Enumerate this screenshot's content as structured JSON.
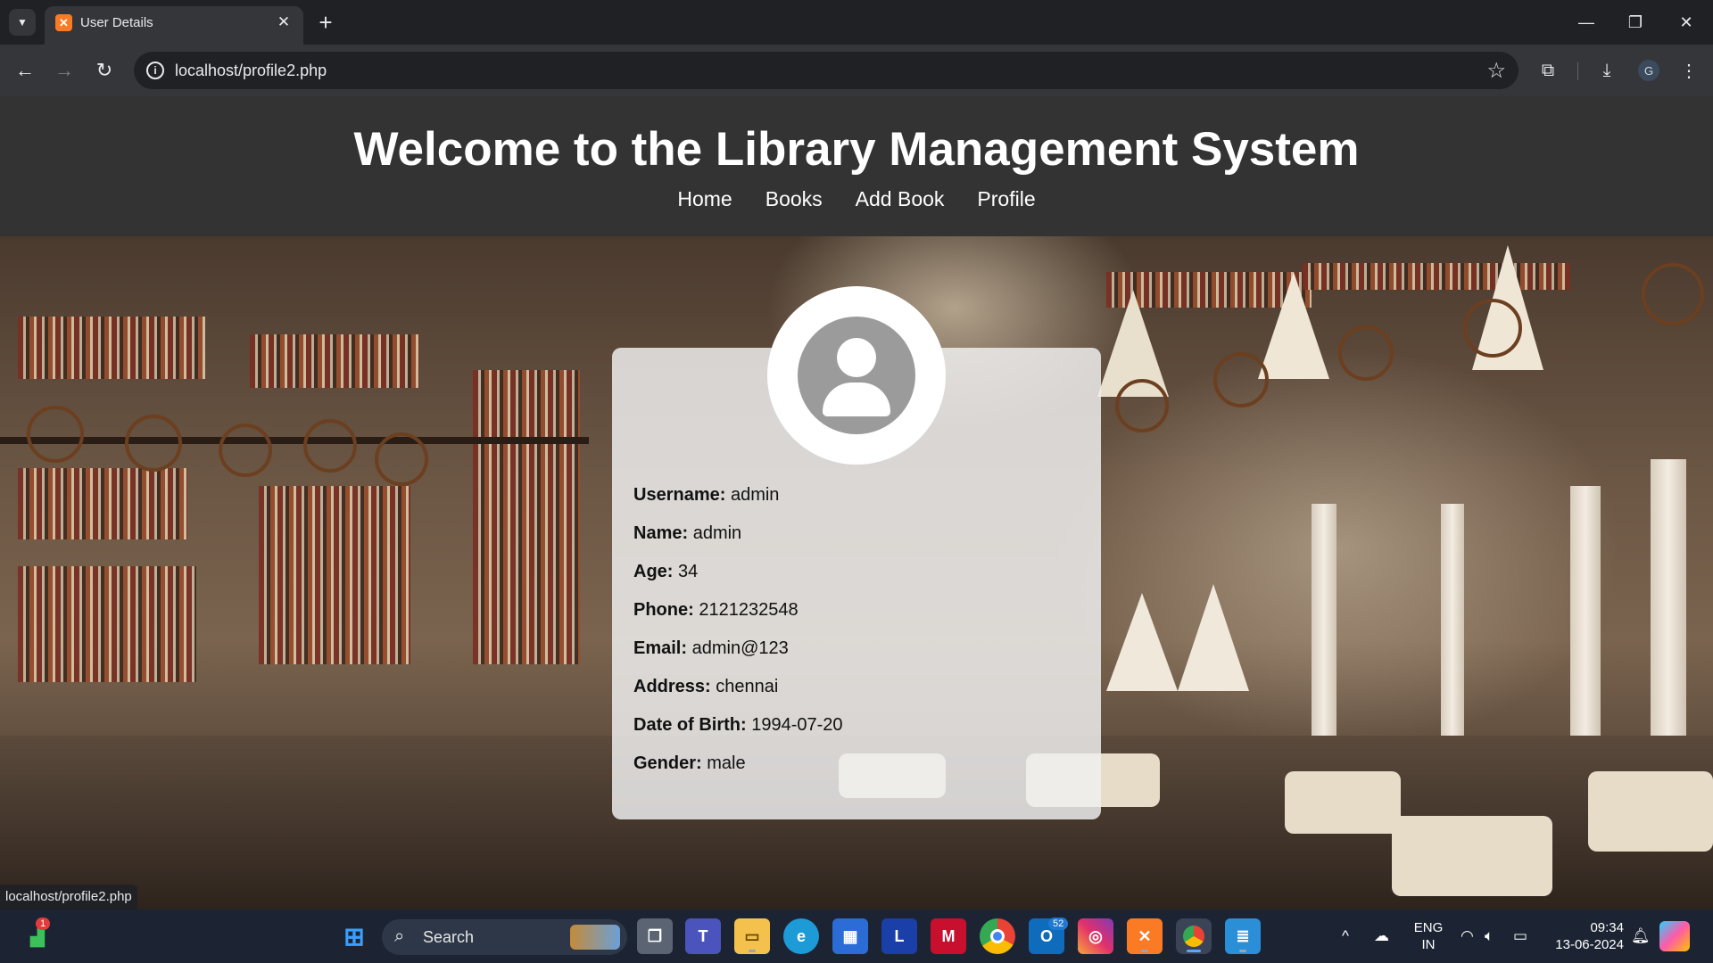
{
  "browser": {
    "tab_title": "User Details",
    "tab_favicon": "xampp-icon",
    "url": "localhost/profile2.php",
    "status_url": "localhost/profile2.php",
    "profile_initial": "G"
  },
  "header": {
    "title": "Welcome to the Library Management System",
    "nav": [
      "Home",
      "Books",
      "Add Book",
      "Profile"
    ]
  },
  "profile": {
    "fields": [
      {
        "label": "Username:",
        "value": "admin"
      },
      {
        "label": "Name:",
        "value": "admin"
      },
      {
        "label": "Age:",
        "value": "34"
      },
      {
        "label": "Phone:",
        "value": "2121232548"
      },
      {
        "label": "Email:",
        "value": "admin@123"
      },
      {
        "label": "Address:",
        "value": "chennai"
      },
      {
        "label": "Date of Birth:",
        "value": "1994-07-20"
      },
      {
        "label": "Gender:",
        "value": "male"
      }
    ]
  },
  "taskbar": {
    "search_label": "Search",
    "widgets_badge": "1",
    "outlook_badge": "52",
    "lang_top": "ENG",
    "lang_bottom": "IN",
    "time": "09:34",
    "date": "13-06-2024",
    "app_L_label": "L"
  },
  "colors": {
    "header_bg": "#333333",
    "card_bg": "rgba(240,240,240,0.84)",
    "browser_bg": "#202124"
  }
}
